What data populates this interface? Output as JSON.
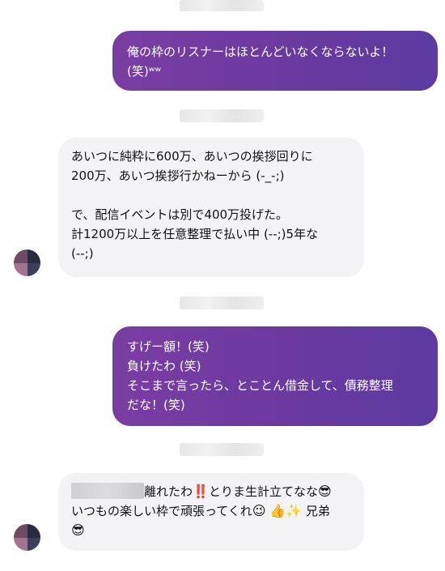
{
  "messages": {
    "m1": {
      "lines": [
        "俺の枠のリスナーはほとんどいなくならないよ！",
        "(笑)ʷʷ"
      ]
    },
    "m2": {
      "lines": [
        "あいつに純粋に600万、あいつの挨拶回りに",
        "200万、あいつ挨拶行かねーから (-_-;)",
        "で、配信イベントは別で400万投げた。",
        "計1200万以上を任意整理で払い中 (--;)5年な",
        "(--;)"
      ]
    },
    "m3": {
      "lines": [
        "すげー額！(笑)",
        "負けたわ (笑)",
        "そこまで言ったら、とことん借金して、債務整理",
        "だな！(笑)"
      ]
    },
    "m4": {
      "line1_text": "離れたわ",
      "line1_text2": "とりま生計立てなな",
      "line2_text": "いつもの楽しい枠で頑張ってくれ",
      "line2_text2": "兄弟"
    }
  },
  "icons": {
    "bangbang": "‼️",
    "sunglasses": "😎",
    "wink": "😉",
    "thumbs_up": "👍",
    "sparkles": "✨"
  },
  "colors": {
    "outgoing_bubble": "#6a3aa0",
    "incoming_bubble": "#f3f3f5",
    "background": "#ffffff"
  }
}
